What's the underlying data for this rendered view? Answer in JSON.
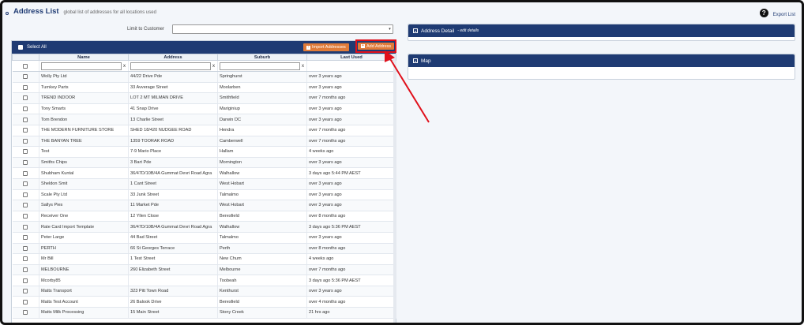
{
  "header": {
    "title": "Address List",
    "subtitle": "global list of addresses for all locations used"
  },
  "export": {
    "label": "Export List",
    "icon": "help-circle-icon"
  },
  "filter": {
    "label": "Limit to Customer",
    "value": ""
  },
  "toolbar": {
    "select_all": "Select All",
    "import_label": "Import Addresses",
    "add_label": "Add Address"
  },
  "columns": [
    "Name",
    "Address",
    "Suburb",
    "Last Used"
  ],
  "clear": "x",
  "rows": [
    [
      "Wolly Pty Ltd",
      "44/22 Drive Pde",
      "Springhurst",
      "over 3 years ago"
    ],
    [
      "Turnkey Parts",
      "33 Avverage Street",
      "Moolarben",
      "over 3 years ago"
    ],
    [
      "TREND INDOOR",
      "LOT 2 MT MILMAN DRIVE",
      "Smithfield",
      "over 7 months ago"
    ],
    [
      "Tony Smarts",
      "41 Snap Drive",
      "Mariginiup",
      "over 3 years ago"
    ],
    [
      "Tom Brendon",
      "13 Charlie Street",
      "Darwin DC",
      "over 3 years ago"
    ],
    [
      "THE MODERN FURNITURE STORE",
      "SHED 18/420 NUDGEE ROAD",
      "Hendra",
      "over 7 months ago"
    ],
    [
      "THE BANYAN TREE",
      "1359 TOORAK ROAD",
      "Camberwell",
      "over 7 months ago"
    ],
    [
      "Test",
      "7-9 Mario Place",
      "Hallam",
      "4 weeks ago"
    ],
    [
      "Smiths Chips",
      "3 Bart Pde",
      "Mornington",
      "over 3 years ago"
    ],
    [
      "Shubham Kuntal",
      "36/47D/10B/4A Gummat Devri Road Agra",
      "Walhallow",
      "3 days ago 5:44 PM AEST"
    ],
    [
      "Sheldon Smit",
      "1 Cant Street",
      "West Hobart",
      "over 3 years ago"
    ],
    [
      "Scale Pty Ltd",
      "33 Junk Street",
      "Talmalmo",
      "over 3 years ago"
    ],
    [
      "Sallys Pies",
      "11 Market Pde",
      "West Hobart",
      "over 3 years ago"
    ],
    [
      "Receiver One",
      "12 Yllen Close",
      "Beresfield",
      "over 8 months ago"
    ],
    [
      "Rate Card Import Template",
      "36/47D/10B/4A Gummat Devri Road Agra",
      "Walhallow",
      "3 days ago 5:36 PM AEST"
    ],
    [
      "Peter Large",
      "44 Bad Street",
      "Talmalmo",
      "over 3 years ago"
    ],
    [
      "PERTH",
      "66 St Georges Terrace",
      "Perth",
      "over 8 months ago"
    ],
    [
      "Mr Bill",
      "1 Test Street",
      "New Chum",
      "4 weeks ago"
    ],
    [
      "MELBOURNE",
      "260 Elizabeth Street",
      "Melbourne",
      "over 7 months ago"
    ],
    [
      "Mcorby85",
      "",
      "Toobeah",
      "3 days ago 5:36 PM AEST"
    ],
    [
      "Matts Transport",
      "323 Pitt Town Road",
      "Kenthurst",
      "over 3 years ago"
    ],
    [
      "Matts Test Account",
      "26 Balook Drive",
      "Beresfield",
      "over 4 months ago"
    ],
    [
      "Matts Milk Processing",
      "15 Main Street",
      "Stony Creek",
      "21 hrs ago"
    ]
  ],
  "detail": {
    "title": "Address Detail",
    "subtitle": "- edit details"
  },
  "map": {
    "title": "Map"
  },
  "colors": {
    "navy": "#1f3b73",
    "orange": "#e07b39",
    "highlight": "#e0101b"
  }
}
